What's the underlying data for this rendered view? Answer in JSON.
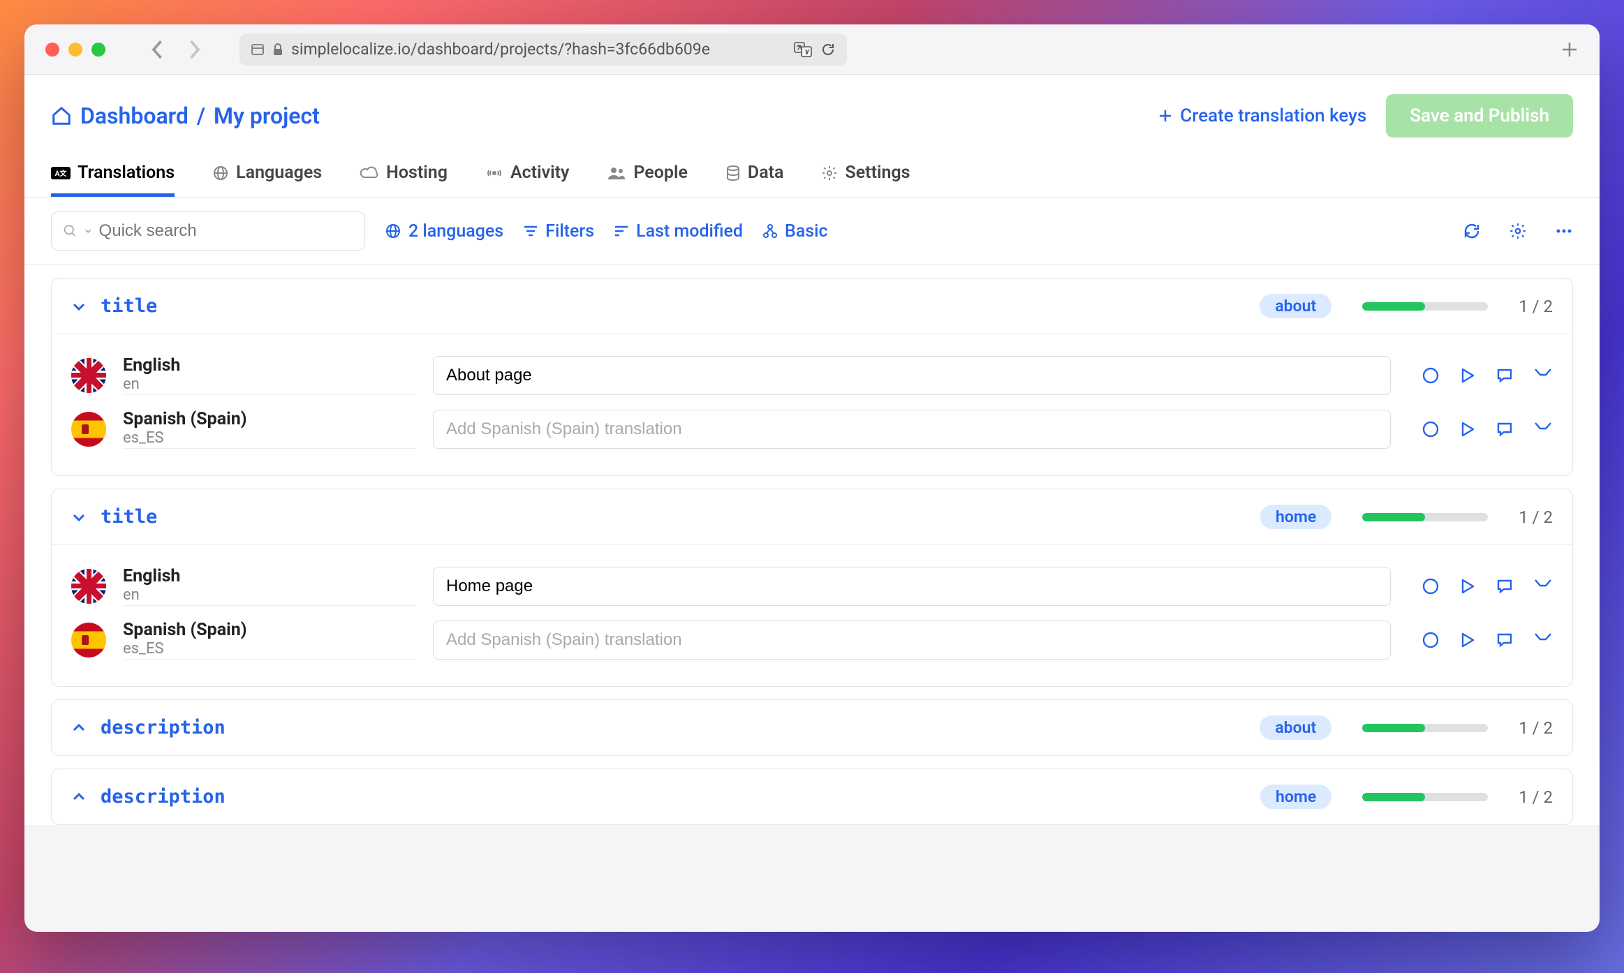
{
  "browser": {
    "url": "simplelocalize.io/dashboard/projects/?hash=3fc66db609e"
  },
  "breadcrumb": {
    "root": "Dashboard",
    "sep": "/",
    "project": "My project"
  },
  "header": {
    "create_label": "Create translation keys",
    "publish_label": "Save and Publish"
  },
  "tabs": [
    {
      "label": "Translations"
    },
    {
      "label": "Languages"
    },
    {
      "label": "Hosting"
    },
    {
      "label": "Activity"
    },
    {
      "label": "People"
    },
    {
      "label": "Data"
    },
    {
      "label": "Settings"
    }
  ],
  "toolbar": {
    "search_placeholder": "Quick search",
    "languages_label": "2 languages",
    "filters_label": "Filters",
    "sort_label": "Last modified",
    "view_label": "Basic"
  },
  "keys": [
    {
      "name": "title",
      "namespace": "about",
      "progress_pct": 50,
      "count": "1 / 2",
      "expanded": true,
      "rows": [
        {
          "lang_name": "English",
          "lang_code": "en",
          "value": "About page",
          "placeholder": ""
        },
        {
          "lang_name": "Spanish (Spain)",
          "lang_code": "es_ES",
          "value": "",
          "placeholder": "Add Spanish (Spain) translation"
        }
      ]
    },
    {
      "name": "title",
      "namespace": "home",
      "progress_pct": 50,
      "count": "1 / 2",
      "expanded": true,
      "rows": [
        {
          "lang_name": "English",
          "lang_code": "en",
          "value": "Home page",
          "placeholder": ""
        },
        {
          "lang_name": "Spanish (Spain)",
          "lang_code": "es_ES",
          "value": "",
          "placeholder": "Add Spanish (Spain) translation"
        }
      ]
    },
    {
      "name": "description",
      "namespace": "about",
      "progress_pct": 50,
      "count": "1 / 2",
      "expanded": false
    },
    {
      "name": "description",
      "namespace": "home",
      "progress_pct": 50,
      "count": "1 / 2",
      "expanded": false
    }
  ]
}
